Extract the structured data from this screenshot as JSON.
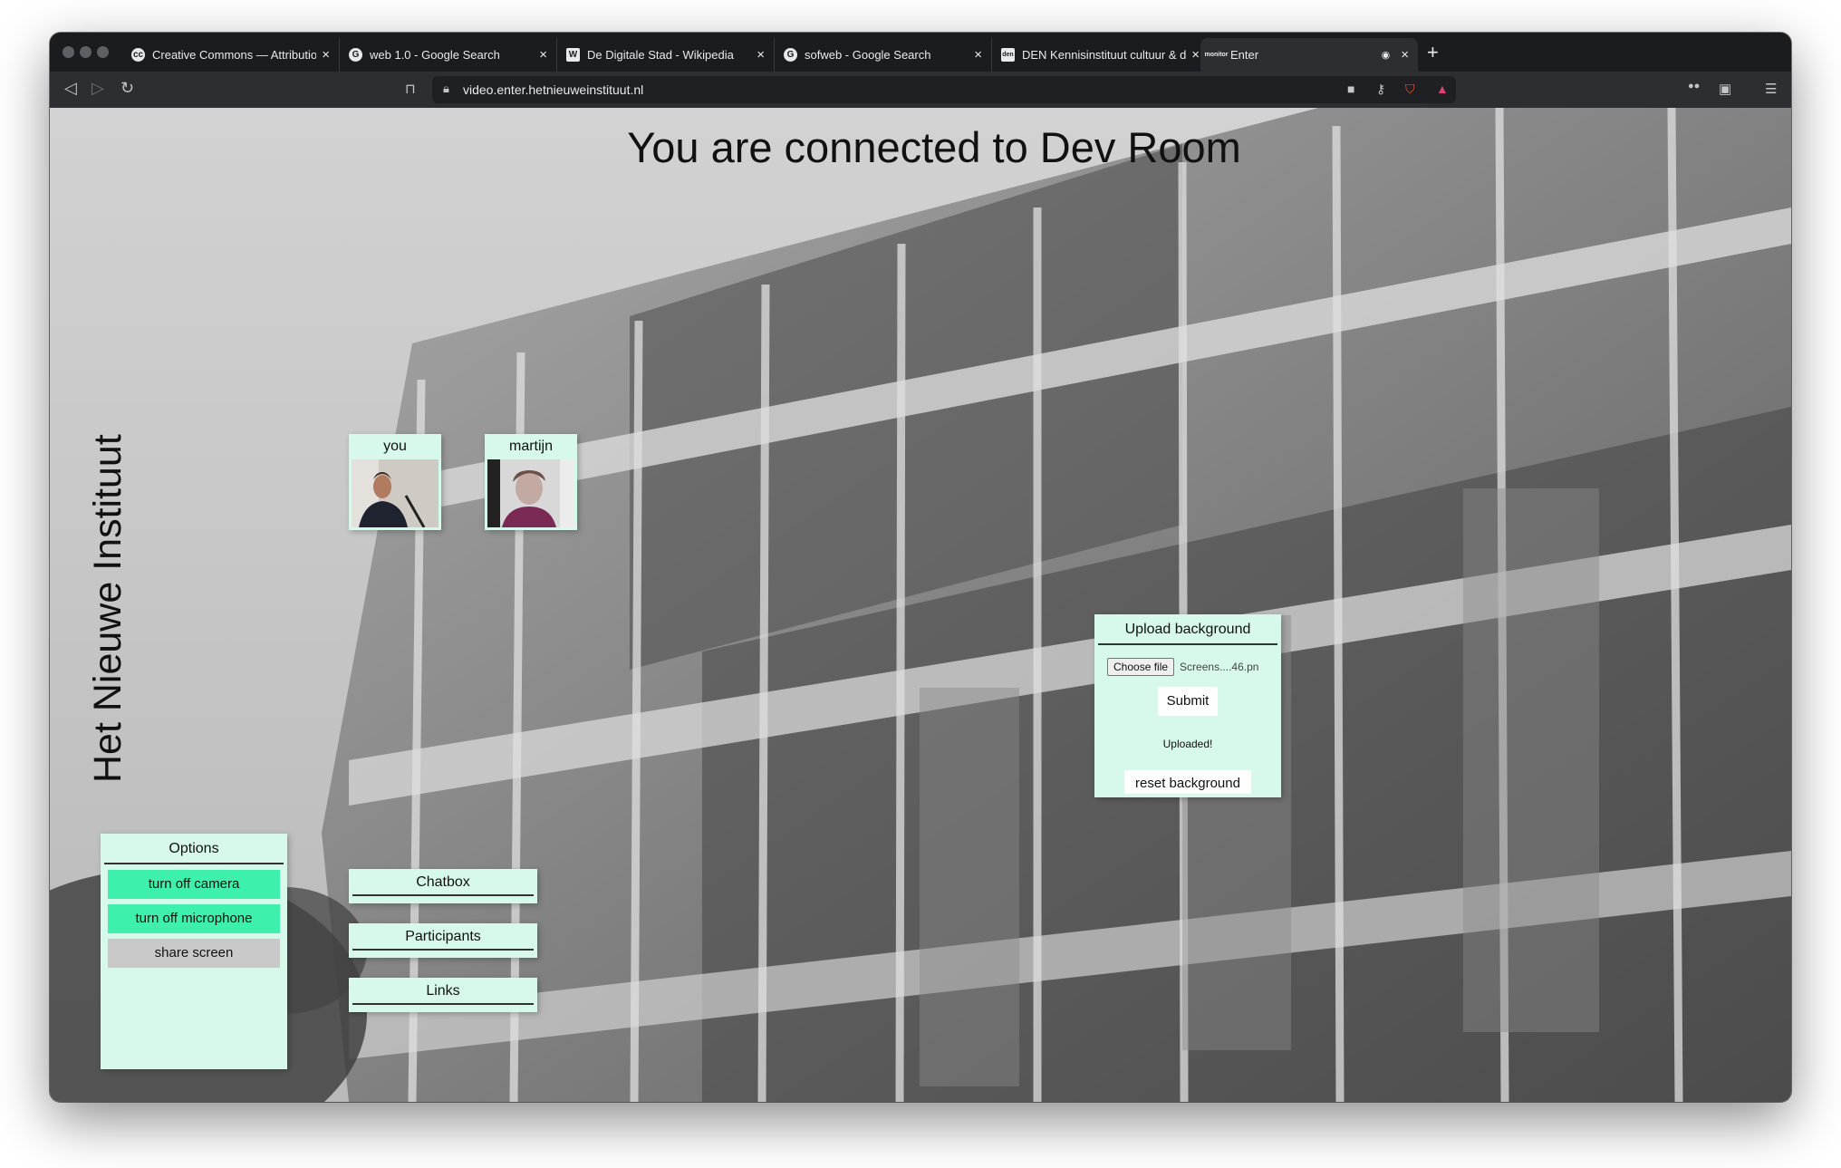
{
  "browser": {
    "tabs": [
      {
        "title": "Creative Commons — Attribution",
        "favicon": "cc"
      },
      {
        "title": "web 1.0 - Google Search",
        "favicon": "G"
      },
      {
        "title": "De Digitale Stad - Wikipedia",
        "favicon": "W"
      },
      {
        "title": "sofweb - Google Search",
        "favicon": "G"
      },
      {
        "title": "DEN Kennisinstituut cultuur & di",
        "favicon": "den"
      },
      {
        "title": "Enter",
        "favicon": "monitor"
      }
    ],
    "close_glyph": "×",
    "new_tab_glyph": "+",
    "url": "video.enter.hetnieuweinstituut.nl"
  },
  "page": {
    "title": "You are connected to Dev Room",
    "logo": "Het Nieuwe Instituut"
  },
  "videos": [
    {
      "label": "you"
    },
    {
      "label": "martijn"
    }
  ],
  "options": {
    "title": "Options",
    "camera": "turn off camera",
    "microphone": "turn off microphone",
    "share": "share screen"
  },
  "sections": {
    "chatbox": "Chatbox",
    "participants": "Participants",
    "links": "Links"
  },
  "upload": {
    "title": "Upload background",
    "choose_label": "Choose file",
    "file_name": "Screens....46.pn",
    "submit": "Submit",
    "status": "Uploaded!",
    "reset": "reset background"
  },
  "colors": {
    "panel_bg": "#d6f9ec",
    "button_green": "#3df0ab",
    "button_grey": "#c9c9c9"
  }
}
